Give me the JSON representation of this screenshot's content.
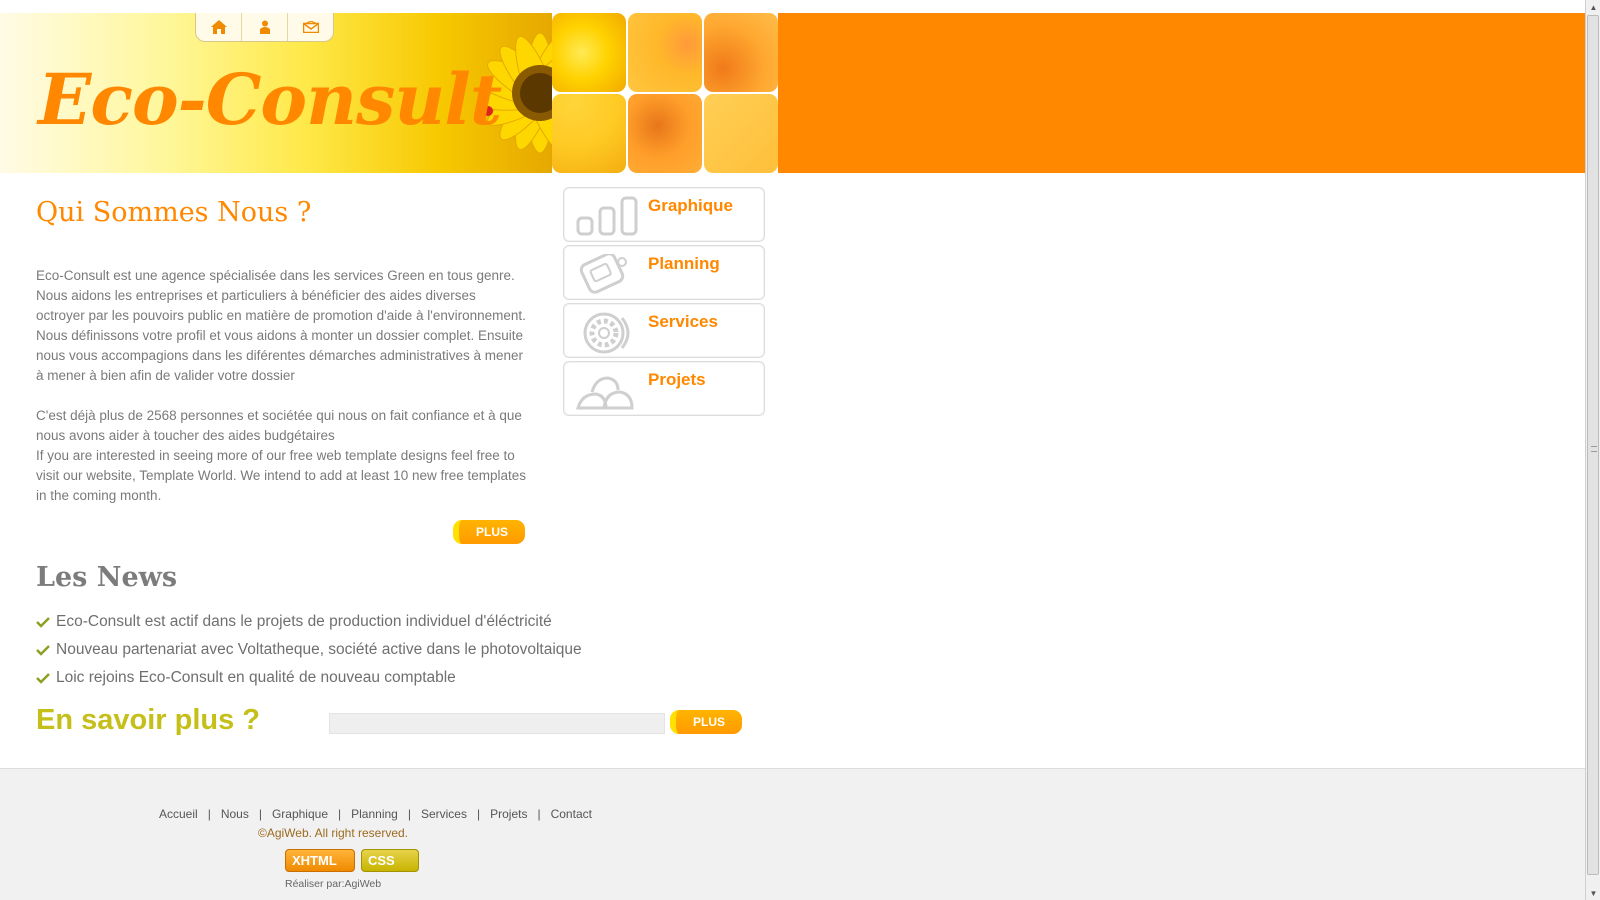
{
  "header": {
    "logo": "Eco-Consult",
    "top_icons": [
      "home-icon",
      "person-icon",
      "mail-icon"
    ]
  },
  "about": {
    "title": "Qui Sommes Nous ?",
    "paragraph1": "Eco-Consult est une agence spécialisée dans les services Green en tous genre. Nous aidons les entreprises et particuliers à bénéficier des aides diverses octroyer par les pouvoirs public en matière de promotion d'aide à l'environnement. Nous définissons votre profil et vous aidons à monter un dossier complet. Ensuite nous vous accompagions dans les diférentes démarches administratives à mener à mener à bien afin de valider votre dossier",
    "paragraph2a": "C'est déjà plus de 2568 personnes et sociétée qui nous on fait confiance et à que nous avons aider à toucher des aides budgétaires",
    "paragraph2b": "If you are interested in seeing more of our free web template designs feel free to visit our website, Template World. We intend to add at least 10 new free templates in the coming month.",
    "more_label": "PLUS"
  },
  "news": {
    "title": "Les News",
    "items": [
      "Eco-Consult est actif dans le projets de production individuel d'éléctricité",
      "Nouveau partenariat avec Voltatheque, société active dans le photovoltaique",
      "Loic rejoins Eco-Consult en qualité de nouveau comptable"
    ]
  },
  "savoir": {
    "title": "En savoir plus ?",
    "input_value": "",
    "button_label": "PLUS"
  },
  "right_menu": [
    {
      "label": "Graphique",
      "icon": "bar-chart-icon"
    },
    {
      "label": "Planning",
      "icon": "planner-icon"
    },
    {
      "label": "Services",
      "icon": "gear-icon"
    },
    {
      "label": "Projets",
      "icon": "stones-icon"
    }
  ],
  "footer": {
    "nav": [
      "Accueil",
      "Nous",
      "Graphique",
      "Planning",
      "Services",
      "Projets",
      "Contact"
    ],
    "copyright": "©AgiWeb. All right reserved.",
    "badge_xhtml": "XHTML",
    "badge_css": "CSS",
    "realise_prefix": "Réaliser par:",
    "realise_name": "AgiWeb"
  },
  "colors": {
    "accent": "#ff8800",
    "savoir": "#c5bf1a",
    "text": "#7a7a7a"
  }
}
